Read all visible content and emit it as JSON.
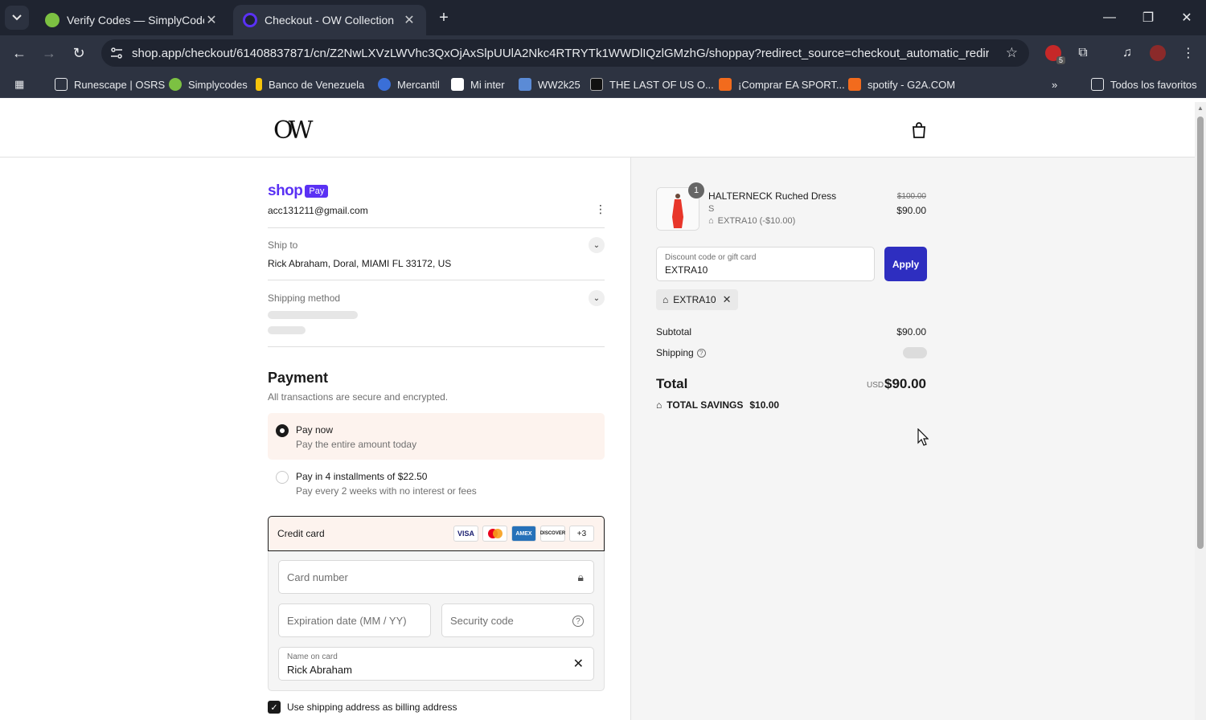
{
  "browser": {
    "tabs": [
      {
        "title": "Verify Codes — SimplyCodes",
        "active": false,
        "color": "#7cc142"
      },
      {
        "title": "Checkout - OW Collection",
        "active": true,
        "color": "#5a31f4"
      }
    ],
    "url": "shop.app/checkout/61408837871/cn/Z2NwLXVzLWVhc3QxOjAxSlpUUlA2Nkc4RTRYTk1WWDlIQzlGMzhG/shoppay?redirect_source=checkout_automatic_redirect&tr...",
    "extension_badge": "5",
    "bookmarks": [
      {
        "label": "Runesc ape | OSRS",
        "icon": "folder-icon"
      },
      {
        "label": "Simplycodes",
        "icon": "simplycodes-icon"
      },
      {
        "label": "Banco de Venezuela",
        "icon": "banco-icon"
      },
      {
        "label": "Mercantil",
        "icon": "mercantil-icon"
      },
      {
        "label": "Mi inter",
        "icon": "inter-icon"
      },
      {
        "label": "WW2k25",
        "icon": "ww-icon"
      },
      {
        "label": "THE LAST OF US O...",
        "icon": "tlou-icon"
      },
      {
        "label": "¡Comprar EA SPORT...",
        "icon": "g2a-icon"
      },
      {
        "label": "spotify - G2A.COM",
        "icon": "g2a-icon"
      }
    ],
    "all_bookmarks": "Todos los favoritos"
  },
  "store": {
    "logo": "OW"
  },
  "contact": {
    "shop_pay_wordmark": "shop",
    "shop_pay_badge": "Pay",
    "email": "acc131211@gmail.com"
  },
  "ship_to": {
    "label": "Ship to",
    "value": "Rick Abraham, Doral, MIAMI FL 33172, US"
  },
  "shipping_method": {
    "label": "Shipping method"
  },
  "payment": {
    "heading": "Payment",
    "subheading": "All transactions are secure and encrypted.",
    "options": [
      {
        "title": "Pay now",
        "subtitle": "Pay the entire amount today",
        "selected": true
      },
      {
        "title": "Pay in 4 installments of $22.50",
        "subtitle": "Pay every 2 weeks with no interest or fees",
        "selected": false
      }
    ],
    "credit_card": {
      "label": "Credit card",
      "brands": [
        "VISA",
        "MC",
        "AMEX",
        "DISCOVER",
        "+3"
      ],
      "card_number_placeholder": "Card number",
      "expiry_placeholder": "Expiration date (MM / YY)",
      "security_placeholder": "Security code",
      "name_label": "Name on card",
      "name_value": "Rick Abraham"
    },
    "billing_checkbox": "Use shipping address as billing address"
  },
  "order": {
    "item": {
      "quantity": "1",
      "name": "HALTERNECK Ruched Dress",
      "variant": "S",
      "discount": "EXTRA10 (-$10.00)",
      "original_price": "$100.00",
      "price": "$90.00"
    },
    "discount_field": {
      "label": "Discount code or gift card",
      "value": "EXTRA10"
    },
    "apply_label": "Apply",
    "applied_code": "EXTRA10",
    "subtotal_label": "Subtotal",
    "subtotal_value": "$90.00",
    "shipping_label": "Shipping",
    "total_label": "Total",
    "currency": "USD",
    "total_value": "$90.00",
    "savings_label": "TOTAL SAVINGS",
    "savings_value": "$10.00"
  },
  "colors": {
    "accent": "#2e2ec0",
    "shop_pay": "#5a31f4",
    "selected_bg": "#fdf3ee"
  }
}
